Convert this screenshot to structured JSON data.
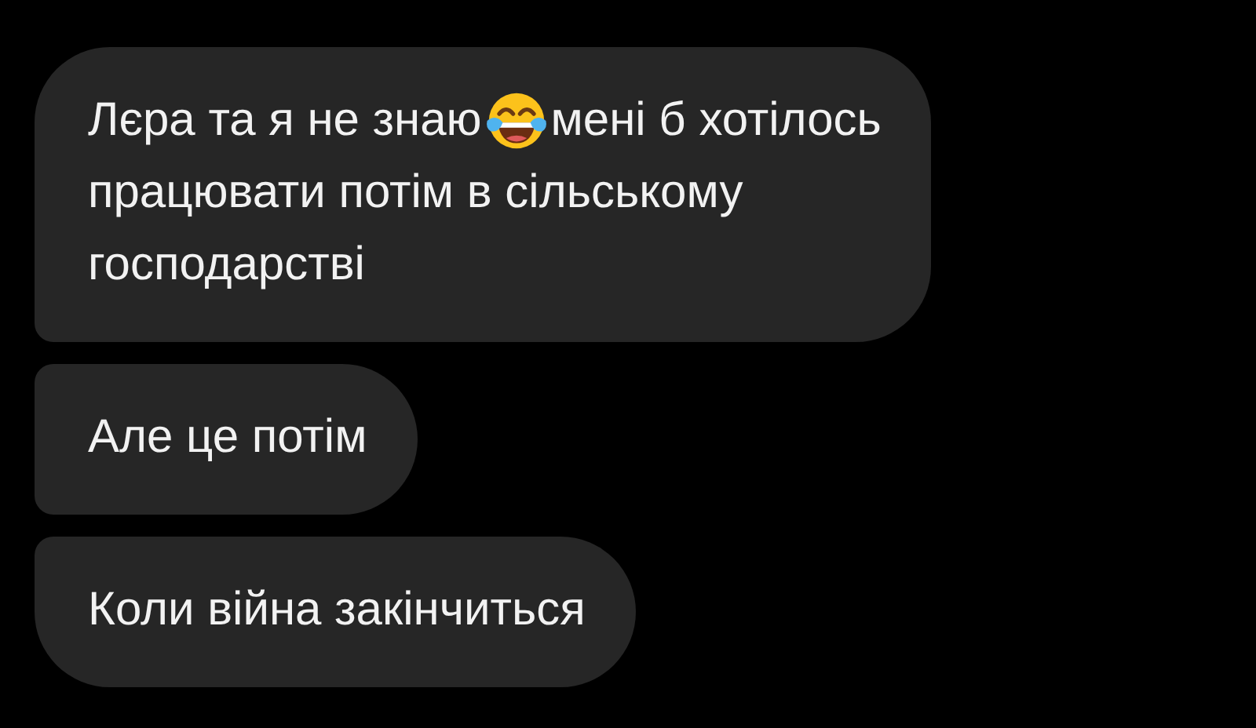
{
  "messages": [
    {
      "lines": [
        [
          {
            "kind": "text",
            "text": "Лєра та я не знаю"
          },
          {
            "kind": "emoji"
          },
          {
            "kind": "text",
            "text": "мені б хотілось"
          }
        ],
        [
          {
            "kind": "text",
            "text": "працювати потім в сільському"
          }
        ],
        [
          {
            "kind": "text",
            "text": "господарстві"
          }
        ]
      ]
    },
    {
      "lines": [
        [
          {
            "kind": "text",
            "text": "Але це потім"
          }
        ]
      ]
    },
    {
      "lines": [
        [
          {
            "kind": "text",
            "text": "Коли війна закінчиться"
          }
        ]
      ]
    }
  ]
}
